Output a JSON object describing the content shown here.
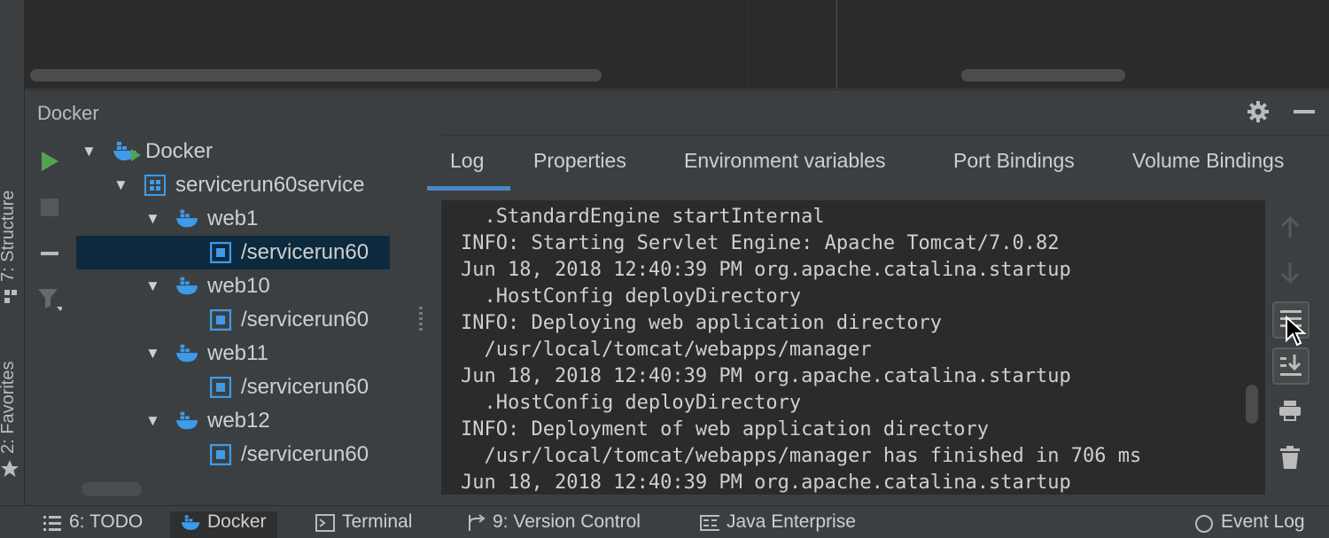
{
  "left_stripe": {
    "structure_label": "7: Structure",
    "favorites_label": "2: Favorites"
  },
  "docker_panel": {
    "title": "Docker"
  },
  "tree": {
    "root": "Docker",
    "compose_project": "servicerun60service",
    "nodes": [
      {
        "service": "web1",
        "container": "/servicerun60"
      },
      {
        "service": "web10",
        "container": "/servicerun60"
      },
      {
        "service": "web11",
        "container": "/servicerun60"
      },
      {
        "service": "web12",
        "container": "/servicerun60"
      }
    ]
  },
  "tabs": [
    "Log",
    "Properties",
    "Environment variables",
    "Port Bindings",
    "Volume Bindings"
  ],
  "active_tab": "Log",
  "log_lines": [
    "  .StandardEngine startInternal",
    "INFO: Starting Servlet Engine: Apache Tomcat/7.0.82",
    "Jun 18, 2018 12:40:39 PM org.apache.catalina.startup",
    "  .HostConfig deployDirectory",
    "INFO: Deploying web application directory",
    "  /usr/local/tomcat/webapps/manager",
    "Jun 18, 2018 12:40:39 PM org.apache.catalina.startup",
    "  .HostConfig deployDirectory",
    "INFO: Deployment of web application directory",
    "  /usr/local/tomcat/webapps/manager has finished in 706 ms",
    "Jun 18, 2018 12:40:39 PM org.apache.catalina.startup"
  ],
  "bottom_bar": {
    "todo": "6: TODO",
    "docker": "Docker",
    "terminal": "Terminal",
    "version_control": "9: Version Control",
    "java_enterprise": "Java Enterprise",
    "event_log": "Event Log"
  },
  "colors": {
    "accent": "#4a88c7",
    "run_green": "#4fa54f",
    "docker_blue": "#3d9be9",
    "selection": "#0d293e"
  }
}
